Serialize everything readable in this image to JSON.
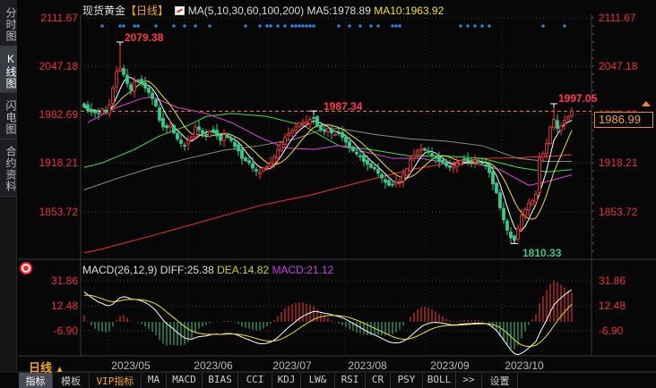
{
  "sidebar": {
    "tabs": [
      {
        "label": "分时图"
      },
      {
        "label": "K线图"
      },
      {
        "label": "闪电图"
      },
      {
        "label": "合约资料"
      }
    ]
  },
  "header": {
    "title": "现货黄金",
    "timeframe": "【日线】",
    "ma_label": "MA(5,10,30,60,100,200)",
    "ma5": "MA5:1978.89",
    "ma10": "MA10:1963.92"
  },
  "price_axis": {
    "labels": [
      "2111.67",
      "2047.18",
      "1982.69",
      "1918.21",
      "1853.72"
    ]
  },
  "current_price": "1986.99",
  "annotations": {
    "high": "2079.38",
    "mid_high": "1987.34",
    "recent_high": "1997.05",
    "low": "1810.33"
  },
  "macd": {
    "label": "MACD(26,12,9)",
    "diff": "DIFF:25.38",
    "dea": "DEA:14.82",
    "macd": "MACD:21.12",
    "axis_labels": [
      "31.86",
      "12.48",
      "-6.90"
    ]
  },
  "x_axis": {
    "period": "日线",
    "period_icon": "▲",
    "dates": [
      "2023/05",
      "2023/06",
      "2023/07",
      "2023/08",
      "2023/09",
      "2023/10"
    ]
  },
  "bottom_tabs": [
    "指标",
    "模板",
    "VIP指标",
    "MA",
    "MACD",
    "BIAS",
    "CCI",
    "KDJ",
    "LW&",
    "RSI",
    "CR",
    "PSY",
    "BOLL",
    ">>",
    "设置"
  ],
  "colors": {
    "up": "#ff3a3a",
    "down": "#3cc88c",
    "ma5": "#ffffff",
    "ma10": "#f0e020",
    "ma30": "#e040e0",
    "ma60": "#40e040",
    "ma100": "#8c8c8c",
    "ma200": "#ff3030",
    "signal": "#2a7fd4",
    "current": "#f08a1c"
  },
  "chart_data": {
    "type": "candlestick",
    "title": "现货黄金 日线",
    "ylim": [
      1790,
      2111.67
    ],
    "closes": [
      1993,
      1988,
      1986,
      1985,
      1984,
      1990,
      1986,
      1995,
      2018,
      2040,
      2044,
      2036,
      2024,
      2016,
      2026,
      2028,
      2024,
      2018,
      2012,
      2004,
      1994,
      1975,
      1966,
      1965,
      1968,
      1958,
      1950,
      1944,
      1941,
      1948,
      1952,
      1966,
      1962,
      1958,
      1956,
      1960,
      1960,
      1954,
      1948,
      1956,
      1952,
      1948,
      1940,
      1934,
      1924,
      1921,
      1918,
      1911,
      1907,
      1905,
      1911,
      1913,
      1918,
      1926,
      1936,
      1945,
      1952,
      1957,
      1961,
      1966,
      1971,
      1972,
      1973,
      1976,
      1978,
      1967,
      1962,
      1960,
      1964,
      1958,
      1956,
      1957,
      1952,
      1946,
      1940,
      1934,
      1930,
      1926,
      1920,
      1916,
      1912,
      1910,
      1904,
      1898,
      1892,
      1888,
      1889,
      1892,
      1894,
      1903,
      1910,
      1922,
      1928,
      1934,
      1937,
      1935,
      1932,
      1928,
      1924,
      1920,
      1918,
      1914,
      1912,
      1915,
      1918,
      1921,
      1922,
      1920,
      1919,
      1922,
      1920,
      1918,
      1914,
      1905,
      1890,
      1878,
      1858,
      1842,
      1828,
      1818,
      1815,
      1830,
      1848,
      1856,
      1864,
      1868,
      1876,
      1924,
      1930,
      1944,
      1966,
      1976,
      1964,
      1968,
      1975,
      1980,
      1986.99
    ],
    "extremes": [
      {
        "index": 10,
        "type": "high",
        "value": 2079.38
      },
      {
        "index": 64,
        "type": "high",
        "value": 1987.34
      },
      {
        "index": 131,
        "type": "high",
        "value": 1997.05
      },
      {
        "index": 120,
        "type": "low",
        "value": 1810.33
      }
    ],
    "ma_series": [
      {
        "name": "MA30",
        "points": [
          [
            1,
            1972
          ],
          [
            9,
            1992
          ],
          [
            16,
            2004
          ],
          [
            19,
            2006
          ],
          [
            26,
            1992
          ],
          [
            34,
            1984
          ],
          [
            41,
            1972
          ],
          [
            49,
            1952
          ],
          [
            56,
            1938
          ],
          [
            64,
            1936
          ],
          [
            71,
            1941
          ],
          [
            79,
            1932
          ],
          [
            86,
            1924
          ],
          [
            94,
            1924
          ],
          [
            101,
            1918
          ],
          [
            109,
            1917
          ],
          [
            116,
            1909
          ],
          [
            124,
            1888
          ],
          [
            129,
            1893
          ],
          [
            136,
            1902
          ]
        ]
      },
      {
        "name": "MA60",
        "points": [
          [
            0,
            1912
          ],
          [
            5,
            1918
          ],
          [
            14,
            1936
          ],
          [
            21,
            1954
          ],
          [
            29,
            1968
          ],
          [
            34,
            1980
          ],
          [
            41,
            1984
          ],
          [
            51,
            1980
          ],
          [
            61,
            1968
          ],
          [
            71,
            1941
          ],
          [
            81,
            1935
          ],
          [
            91,
            1927
          ],
          [
            101,
            1927
          ],
          [
            111,
            1924
          ],
          [
            121,
            1912
          ],
          [
            129,
            1906
          ],
          [
            136,
            1909
          ]
        ]
      },
      {
        "name": "MA100",
        "points": [
          [
            0,
            1882
          ],
          [
            9,
            1897
          ],
          [
            19,
            1912
          ],
          [
            29,
            1924
          ],
          [
            39,
            1935
          ],
          [
            49,
            1941
          ],
          [
            59,
            1950
          ],
          [
            66,
            1962
          ],
          [
            71,
            1964
          ],
          [
            81,
            1956
          ],
          [
            91,
            1950
          ],
          [
            101,
            1947
          ],
          [
            111,
            1941
          ],
          [
            121,
            1924
          ],
          [
            129,
            1920
          ],
          [
            136,
            1920
          ]
        ]
      },
      {
        "name": "MA200",
        "points": [
          [
            0,
            1798
          ],
          [
            5,
            1803
          ],
          [
            19,
            1821
          ],
          [
            34,
            1841
          ],
          [
            49,
            1861
          ],
          [
            64,
            1876
          ],
          [
            71,
            1885
          ],
          [
            81,
            1897
          ],
          [
            91,
            1909
          ],
          [
            101,
            1917
          ],
          [
            111,
            1924
          ],
          [
            121,
            1925
          ],
          [
            131,
            1927
          ],
          [
            136,
            1929
          ]
        ]
      }
    ],
    "signal_dots": [
      5,
      10,
      11,
      14,
      15,
      20,
      25,
      28,
      31,
      35,
      45,
      49,
      51,
      52,
      54,
      56,
      58,
      59,
      60,
      61,
      62,
      63,
      64,
      71,
      74,
      77,
      80,
      82,
      86,
      87,
      88,
      105,
      107,
      109,
      111,
      113,
      128,
      134
    ],
    "macd_params": [
      26,
      12,
      9
    ],
    "macd_ylim": [
      -6.9,
      31.86
    ]
  }
}
